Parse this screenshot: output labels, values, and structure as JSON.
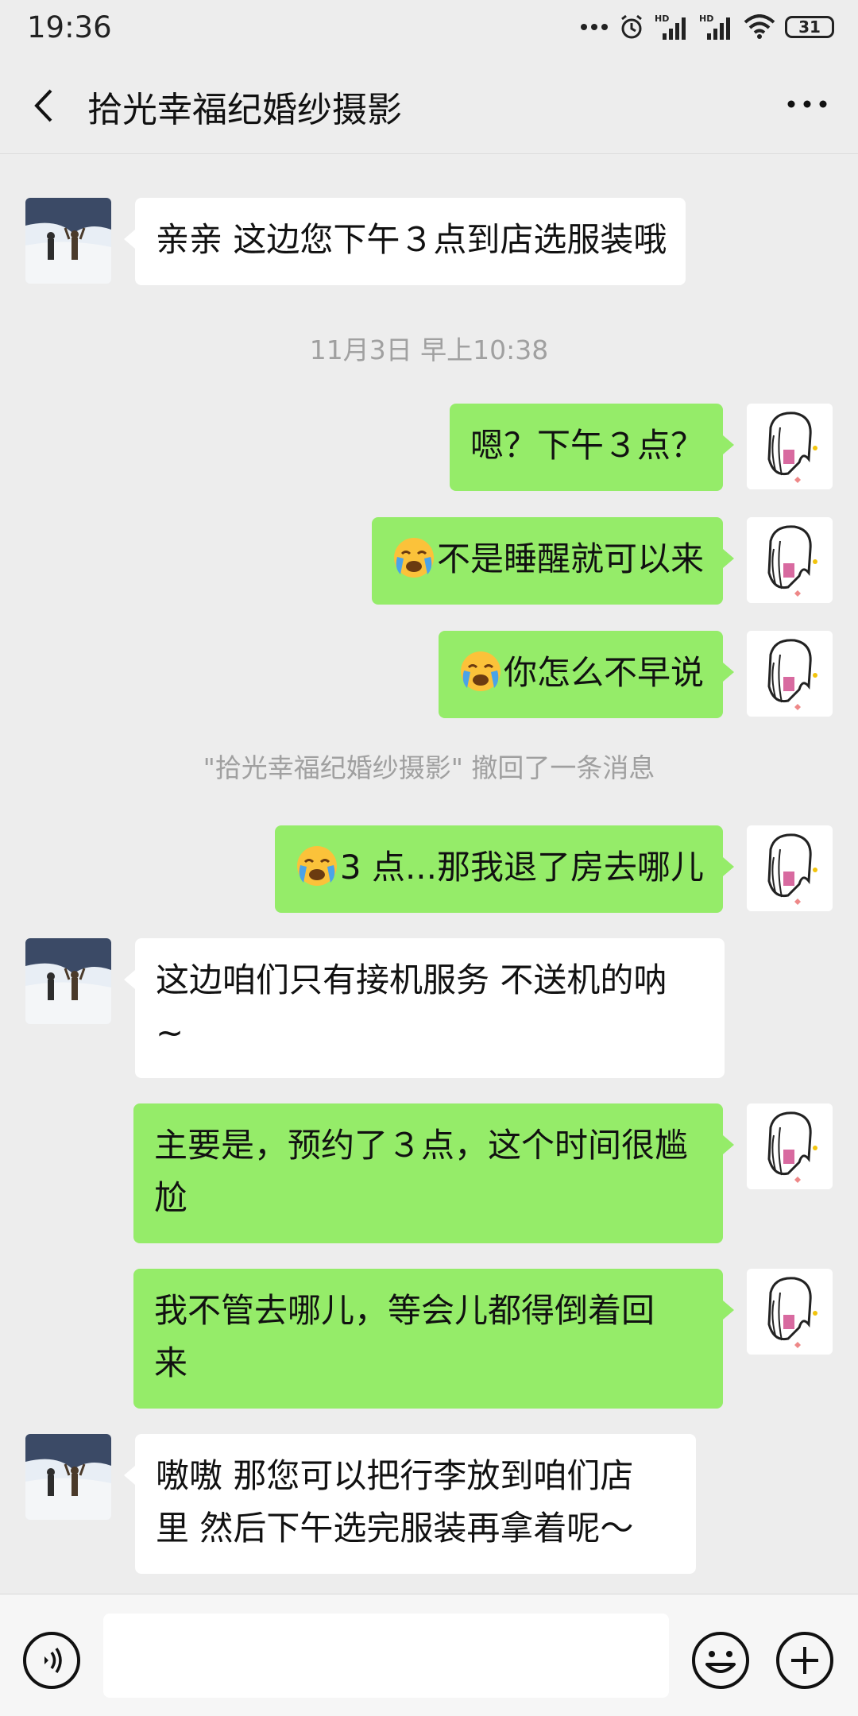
{
  "status_bar": {
    "time": "19:36",
    "hd1": "HD",
    "hd2": "HD",
    "battery": "31"
  },
  "header": {
    "title": "拾光幸福纪婚纱摄影"
  },
  "messages": {
    "m1": "亲亲 这边您下午３点到店选服装哦",
    "timestamp": "11月3日 早上10:38",
    "m2": "嗯？下午３点？",
    "m3": "不是睡醒就可以来",
    "m4": "你怎么不早说",
    "recall": "\"拾光幸福纪婚纱摄影\" 撤回了一条消息",
    "m5": "3 点...那我退了房去哪儿",
    "m6_line1": "这边咱们只有接机服务 不送机的呐",
    "m6_line2": "~",
    "m7_line1": "主要是，预约了３点，这个时间很尴",
    "m7_line2": "尬",
    "m8_line1": "我不管去哪儿，等会儿都得倒着回",
    "m8_line2": "来",
    "m9_line1": "嗷嗷 那您可以把行李放到咱们店",
    "m9_line2": "里  然后下午选完服装再拿着呢～"
  },
  "input": {
    "value": ""
  },
  "icons": {
    "back": "back-arrow-icon",
    "more": "more-dots-icon",
    "voice": "voice-icon",
    "emoji": "emoji-icon",
    "plus": "plus-icon",
    "cry_emoji": "loudly-crying-face-icon"
  },
  "colors": {
    "sent_bubble": "#95ec69",
    "received_bubble": "#ffffff",
    "background": "#ededed"
  }
}
